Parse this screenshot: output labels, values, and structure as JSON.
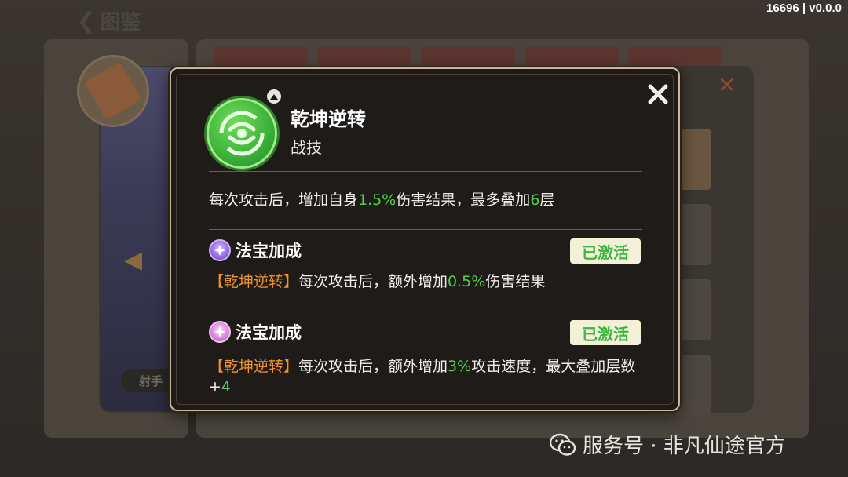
{
  "app": {
    "version": "16696 | v0.0.0"
  },
  "background": {
    "header_title": "图鉴",
    "class_tag": "射手"
  },
  "popup": {
    "skill": {
      "name": "乾坤逆转",
      "type": "战技",
      "icon": "swirl-arrows-icon",
      "desc_parts": [
        "每次攻击后，增加自身",
        "1.5%",
        "伤害结果，最多叠加",
        "6",
        "层"
      ]
    },
    "bonuses": [
      {
        "title": "法宝加成",
        "icon": "purple-gem-icon",
        "status": "已激活",
        "tag": "【乾坤逆转】",
        "desc_parts": [
          "每次攻击后，额外增加",
          "0.5%",
          "伤害结果"
        ]
      },
      {
        "title": "法宝加成",
        "icon": "pink-gem-icon",
        "status": "已激活",
        "tag": "【乾坤逆转】",
        "desc_parts": [
          "每次攻击后，额外增加",
          "3%",
          "攻击速度，最大叠加层数+",
          "4"
        ]
      }
    ]
  },
  "watermark": {
    "text": "服务号 · 非凡仙途官方"
  },
  "colors": {
    "highlight_green": "#4fd24a",
    "tag_orange": "#f0912e",
    "badge_text_green": "#3bb640",
    "popup_bg": "#1f1b18",
    "popup_border": "#c9b89a"
  }
}
